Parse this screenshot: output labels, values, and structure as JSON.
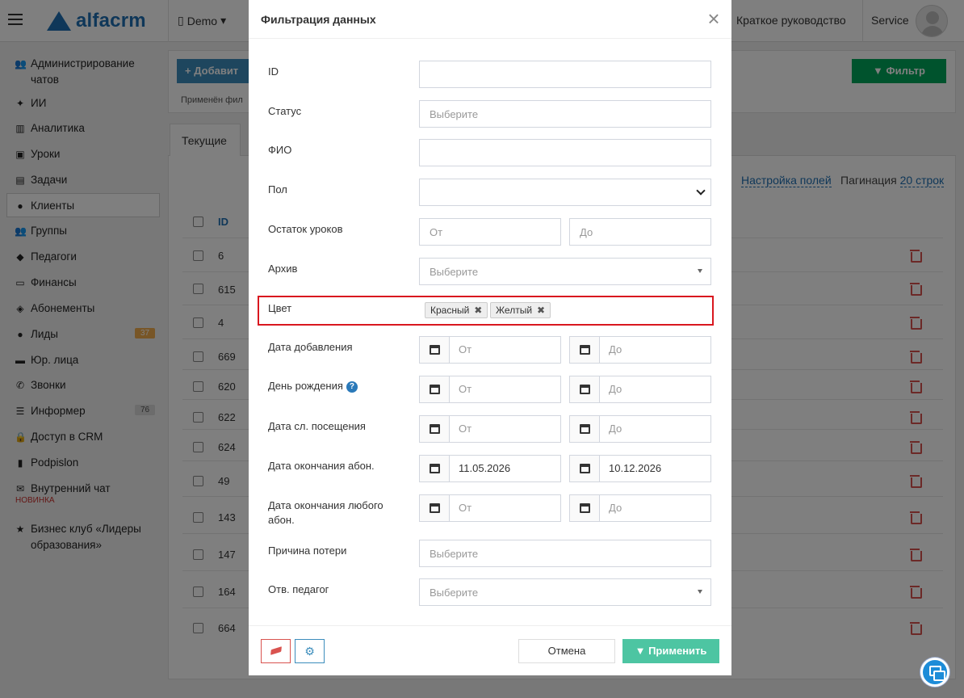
{
  "header": {
    "logo_text": "alfacrm",
    "demo_label": "Demo",
    "guide_label": "Краткое руководство",
    "user_label": "Service"
  },
  "sidebar": {
    "items": [
      {
        "label": "Администрирование чатов",
        "icon": "users-icon"
      },
      {
        "label": "ИИ",
        "icon": "sparkles-icon"
      },
      {
        "label": "Аналитика",
        "icon": "map-icon"
      },
      {
        "label": "Уроки",
        "icon": "calendar-icon"
      },
      {
        "label": "Задачи",
        "icon": "clipboard-icon"
      },
      {
        "label": "Клиенты",
        "icon": "user-icon"
      },
      {
        "label": "Группы",
        "icon": "group-icon"
      },
      {
        "label": "Педагоги",
        "icon": "graduation-cap-icon"
      },
      {
        "label": "Финансы",
        "icon": "money-icon"
      },
      {
        "label": "Абонементы",
        "icon": "tag-icon"
      },
      {
        "label": "Лиды",
        "icon": "user-plus-icon"
      },
      {
        "label": "Юр. лица",
        "icon": "briefcase-icon"
      },
      {
        "label": "Звонки",
        "icon": "phone-icon"
      },
      {
        "label": "Информер",
        "icon": "list-icon"
      },
      {
        "label": "Доступ в CRM",
        "icon": "lock-icon"
      },
      {
        "label": "Podpislon",
        "icon": "document-icon"
      },
      {
        "label": "Внутренний чат",
        "icon": "envelope-icon"
      },
      {
        "label": "Бизнес клуб «Лидеры образования»",
        "icon": "star-icon"
      }
    ],
    "leads_badge": "37",
    "informer_badge": "76",
    "new_tag": "НОВИНКА"
  },
  "main": {
    "add_button": "+ Добавит",
    "filter_button": "Фильтр",
    "applied_text": "Применён фил",
    "tab_current": "Текущие",
    "fields_settings": "Настройка полей",
    "pagination_label": "Пагинация",
    "pagination_value": "20 строк",
    "id_header": "ID",
    "rows": [
      "6",
      "615",
      "4",
      "669",
      "620",
      "622",
      "624",
      "49",
      "143",
      "147",
      "164",
      "664"
    ]
  },
  "modal": {
    "title": "Фильтрация данных",
    "close": "×",
    "fields": {
      "id_label": "ID",
      "status_label": "Статус",
      "status_placeholder": "Выберите",
      "fio_label": "ФИО",
      "gender_label": "Пол",
      "lessons_left_label": "Остаток уроков",
      "from_placeholder": "От",
      "to_placeholder": "До",
      "archive_label": "Архив",
      "archive_placeholder": "Выберите",
      "color_label": "Цвет",
      "color_tags": [
        "Красный",
        "Желтый"
      ],
      "date_added_label": "Дата добавления",
      "birthday_label": "День рождения",
      "last_visit_label": "Дата сл. посещения",
      "sub_end_label": "Дата окончания абон.",
      "sub_end_from": "11.05.2026",
      "sub_end_to": "10.12.2026",
      "any_sub_end_label": "Дата окончания любого абон.",
      "loss_reason_label": "Причина потери",
      "loss_reason_placeholder": "Выберите",
      "teacher_label": "Отв. педагог",
      "teacher_placeholder": "Выберите"
    },
    "footer": {
      "cancel": "Отмена",
      "apply": "Применить"
    }
  },
  "colors": {
    "primary": "#3c8dbc",
    "success": "#00a65a",
    "apply": "#4dc5a2",
    "danger": "#d9534f",
    "highlight": "#d9171f"
  }
}
